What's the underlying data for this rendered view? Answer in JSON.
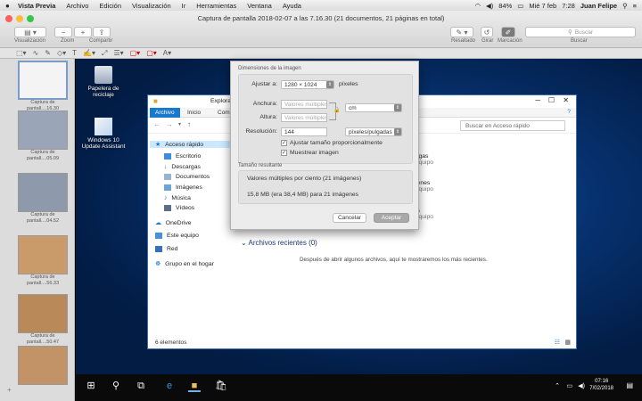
{
  "menubar": {
    "apple": "",
    "items": [
      "Vista Previa",
      "Archivo",
      "Edición",
      "Visualización",
      "Ir",
      "Herramientas",
      "Ventana",
      "Ayuda"
    ],
    "battery": "84%",
    "date": "Mié 7 feb",
    "time": "7:28",
    "user": "Juan Felipe"
  },
  "window": {
    "title": "Captura de pantalla 2018-02-07 a las 7.16.30 (21 documentos, 21 páginas en total)",
    "toolbar": {
      "view_label": "Visualización",
      "zoom_label": "Zoom",
      "share_label": "Compartir",
      "highlight_label": "Resaltado",
      "rotate_label": "Girar",
      "markup_label": "Marcación",
      "search_placeholder": "Buscar",
      "search_label": "Buscar"
    }
  },
  "sidebar": {
    "thumbnails": [
      {
        "caption": "Captura de pantall....16.30",
        "color": "#f4f4f4"
      },
      {
        "caption": "Captura de pantall....05.09",
        "color": "#9aa6b8"
      },
      {
        "caption": "Captura de pantall....04.52",
        "color": "#8e9aac"
      },
      {
        "caption": "Captura de pantall....56.33",
        "color": "#c99a6a"
      },
      {
        "caption": "Captura de pantall....50.47",
        "color": "#b9895a"
      },
      {
        "caption": "",
        "color": "#c29366"
      }
    ]
  },
  "desktop": {
    "recycle_bin": "Papelera de reciclaje",
    "update_assistant": "Windows 10 Update Assistant"
  },
  "explorer": {
    "title": "Explorador",
    "tabs": [
      "Archivo",
      "Inicio",
      "Com"
    ],
    "search_placeholder": "Buscar en Acceso rápido",
    "nav": [
      "Acceso rápido",
      "Escritorio",
      "Descargas",
      "Documentos",
      "Imágenes",
      "Música",
      "Vídeos",
      "OneDrive",
      "Este equipo",
      "Red",
      "Grupo en el hogar"
    ],
    "folders": [
      {
        "name": "cargas",
        "location": "e equipo"
      },
      {
        "name": "ágenes",
        "location": "e equipo"
      },
      {
        "name": "eos",
        "location": "e equipo"
      }
    ],
    "recent_header": "Archivos recientes (0)",
    "recent_empty": "Después de abrir algunos archivos, aquí te mostraremos los más recientes.",
    "status": "6 elementos"
  },
  "dialog": {
    "section_dimensions": "Dimensiones de la imagen",
    "fit_label": "Ajustar a:",
    "fit_value": "1280 × 1024",
    "fit_unit": "píxeles",
    "width_label": "Anchura:",
    "width_placeholder": "Valores múltiples",
    "height_label": "Altura:",
    "height_placeholder": "Valores múltiples",
    "size_unit": "cm",
    "resolution_label": "Resolución:",
    "resolution_value": "144",
    "resolution_unit": "píxeles/pulgadas",
    "proportional_label": "Ajustar tamaño proporcionalmente",
    "resample_label": "Muestrear imagen",
    "section_result": "Tamaño resultante",
    "result_multiple": "Valores múltiples por ciento (21 imágenes)",
    "result_size": "15,8 MB (era 38,4 MB) para 21 imágenes",
    "cancel_label": "Cancelar",
    "accept_label": "Aceptar"
  },
  "taskbar": {
    "time": "07:16",
    "date": "7/02/2018"
  },
  "colors": {
    "accent": "#1979ca",
    "desktop": "#06306c"
  }
}
